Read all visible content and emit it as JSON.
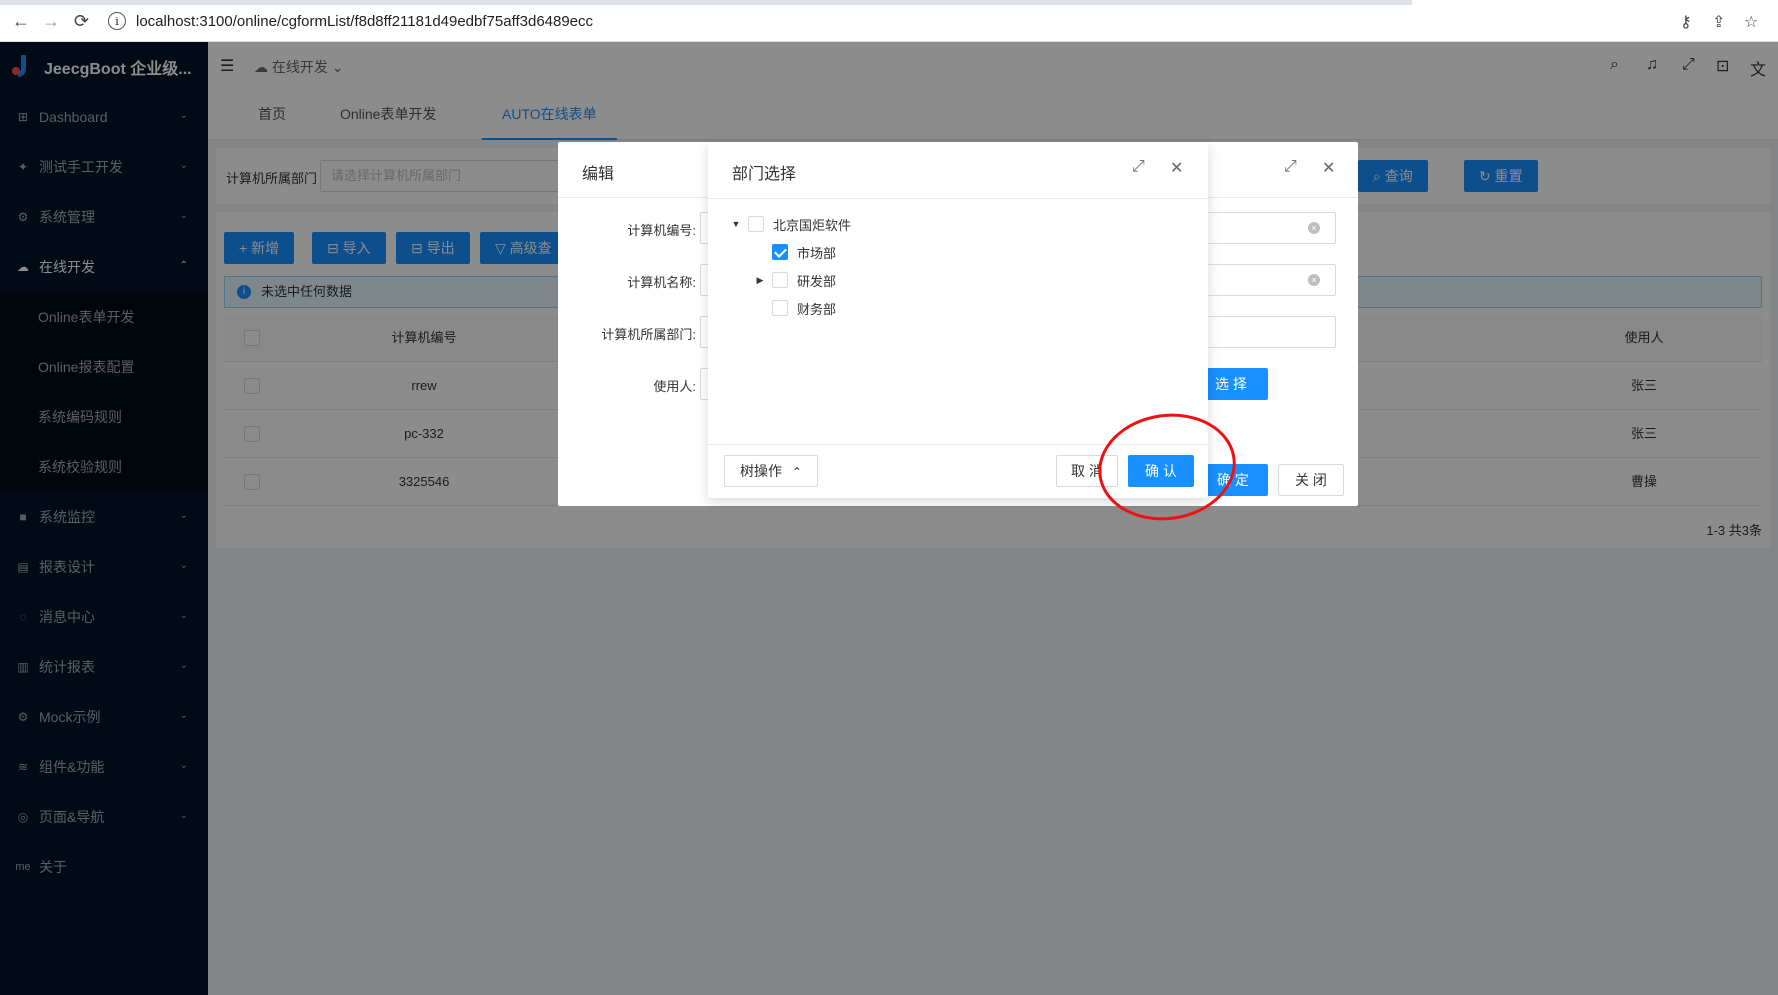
{
  "browser": {
    "url": "localhost:3100/online/cgformList/f8d8ff21181d49edbf75aff3d6489ecc"
  },
  "sidebar": {
    "logo": "JeecgBoot 企业级...",
    "items": [
      {
        "label": "Dashboard",
        "icon": "dashboard-icon"
      },
      {
        "label": "测试手工开发",
        "icon": "twitter-icon"
      },
      {
        "label": "系统管理",
        "icon": "setting-icon"
      },
      {
        "label": "在线开发",
        "icon": "cloud-icon"
      },
      {
        "label": "系统监控",
        "icon": "video-icon"
      },
      {
        "label": "报表设计",
        "icon": "report-icon"
      },
      {
        "label": "消息中心",
        "icon": "message-icon"
      },
      {
        "label": "统计报表",
        "icon": "chart-icon"
      },
      {
        "label": "Mock示例",
        "icon": "mock-icon"
      },
      {
        "label": "组件&功能",
        "icon": "database-icon"
      },
      {
        "label": "页面&导航",
        "icon": "page-icon"
      },
      {
        "label": "关于",
        "icon": "me-icon",
        "icon_text": "me"
      }
    ],
    "sub_items": [
      "Online表单开发",
      "Online报表配置",
      "系统编码规则",
      "系统校验规则"
    ]
  },
  "header": {
    "breadcrumb": "在线开发"
  },
  "tabs": [
    "首页",
    "Online表单开发",
    "AUTO在线表单"
  ],
  "search": {
    "label": "计算机所属部门",
    "placeholder": "请选择计算机所属部门",
    "query_label": "查询",
    "reset_label": "重置"
  },
  "toolbar": {
    "add": "新增",
    "import": "导入",
    "export": "导出",
    "advanced": "高级查"
  },
  "alert": "未选中任何数据",
  "table": {
    "headers": [
      "计算机编号",
      "使用人"
    ],
    "rows": [
      {
        "code": "rrew",
        "user": "张三"
      },
      {
        "code": "pc-332",
        "user": "张三"
      },
      {
        "code": "3325546",
        "user": "曹操"
      }
    ],
    "pagination": "1-3 共3条"
  },
  "edit_modal": {
    "title": "编辑",
    "fields": [
      "计算机编号:",
      "计算机名称:",
      "计算机所属部门:",
      "使用人:"
    ],
    "select_label": "选 择",
    "ok_label": "确 定",
    "close_label": "关 闭"
  },
  "dept_modal": {
    "title": "部门选择",
    "tree": [
      {
        "label": "北京国炬软件",
        "checked": false,
        "expanded": true
      },
      {
        "label": "市场部",
        "checked": true
      },
      {
        "label": "研发部",
        "checked": false,
        "collapsed": true
      },
      {
        "label": "财务部",
        "checked": false
      }
    ],
    "tree_ops_label": "树操作",
    "cancel_label": "取 消",
    "confirm_label": "确 认"
  },
  "colors": {
    "primary": "#1890ff",
    "sidebar_bg": "#001529",
    "annotation": "#ee1111"
  }
}
